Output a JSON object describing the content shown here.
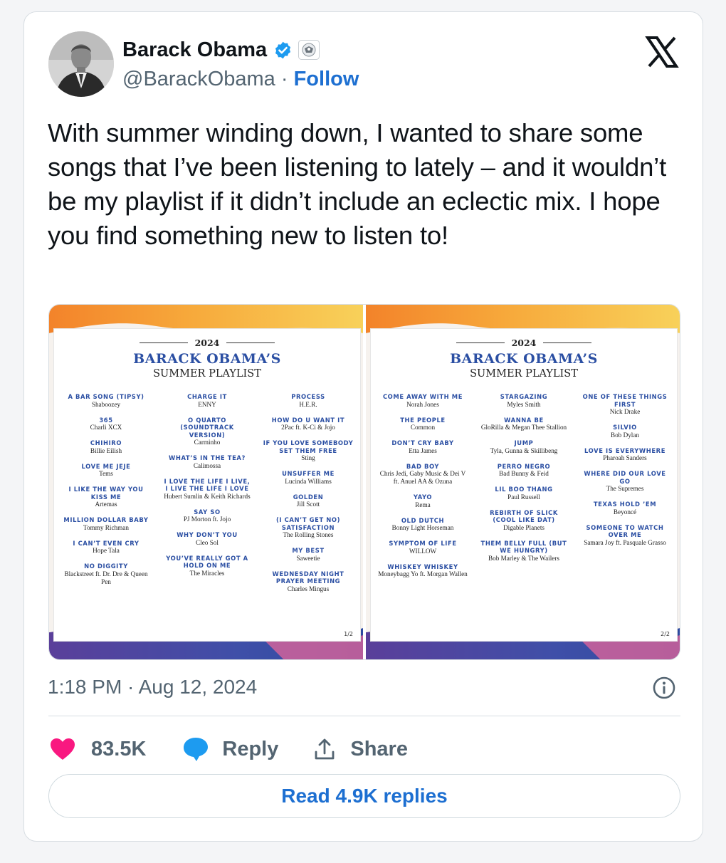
{
  "tweet": {
    "author_name": "Barack Obama",
    "handle": "@BarackObama",
    "separator": "·",
    "follow_label": "Follow",
    "text": "With summer winding down, I wanted to share some songs that I’ve been listening to lately – and it wouldn’t be my playlist if it didn’t include an eclectic mix. I hope you find something new to listen to!",
    "timestamp": "1:18 PM · Aug 12, 2024",
    "like_count": "83.5K",
    "reply_label": "Reply",
    "share_label": "Share",
    "read_replies_label": "Read 4.9K replies"
  },
  "colors": {
    "follow_blue": "#1d6fd1",
    "heart_red": "#f91880",
    "bubble_blue": "#1d9bf0",
    "playlist_blue": "#2b4fa3"
  },
  "icons": [
    "verified-badge-icon",
    "government-seal-icon",
    "x-logo-icon",
    "info-icon",
    "heart-icon",
    "reply-bubble-icon",
    "share-icon"
  ],
  "playlist_images": [
    {
      "year": "2024",
      "title": "BARACK OBAMA’S",
      "subtitle": "SUMMER PLAYLIST",
      "page": "1/2",
      "columns": [
        [
          {
            "title": "A BAR SONG (TIPSY)",
            "artist": "Shaboozey"
          },
          {
            "title": "365",
            "artist": "Charli XCX"
          },
          {
            "title": "CHIHIRO",
            "artist": "Billie Eilish"
          },
          {
            "title": "LOVE ME JEJE",
            "artist": "Tems"
          },
          {
            "title": "I LIKE THE WAY YOU KISS ME",
            "artist": "Artemas"
          },
          {
            "title": "MILLION DOLLAR BABY",
            "artist": "Tommy Richman"
          },
          {
            "title": "I CAN’T EVEN CRY",
            "artist": "Hope Tala"
          },
          {
            "title": "NO DIGGITY",
            "artist": "Blackstreet ft. Dr. Dre & Queen Pen"
          }
        ],
        [
          {
            "title": "CHARGE IT",
            "artist": "ENNY"
          },
          {
            "title": "O QUARTO (SOUNDTRACK VERSION)",
            "artist": "Carminho"
          },
          {
            "title": "WHAT’S IN THE TEA?",
            "artist": "Calimossa"
          },
          {
            "title": "I LOVE THE LIFE I LIVE, I LIVE THE LIFE I LOVE",
            "artist": "Hubert Sumlin & Keith Richards"
          },
          {
            "title": "SAY SO",
            "artist": "PJ Morton ft. Jojo"
          },
          {
            "title": "WHY DON’T YOU",
            "artist": "Cleo Sol"
          },
          {
            "title": "YOU’VE REALLY GOT A HOLD ON ME",
            "artist": "The Miracles"
          }
        ],
        [
          {
            "title": "PROCESS",
            "artist": "H.E.R."
          },
          {
            "title": "HOW DO U WANT IT",
            "artist": "2Pac ft. K-Ci & Jojo"
          },
          {
            "title": "IF YOU LOVE SOMEBODY SET THEM FREE",
            "artist": "Sting"
          },
          {
            "title": "UNSUFFER ME",
            "artist": "Lucinda Williams"
          },
          {
            "title": "GOLDEN",
            "artist": "Jill Scott"
          },
          {
            "title": "(I CAN’T GET NO) SATISFACTION",
            "artist": "The Rolling Stones"
          },
          {
            "title": "MY BEST",
            "artist": "Saweetie"
          },
          {
            "title": "WEDNESDAY NIGHT PRAYER MEETING",
            "artist": "Charles Mingus"
          }
        ]
      ]
    },
    {
      "year": "2024",
      "title": "BARACK OBAMA’S",
      "subtitle": "SUMMER PLAYLIST",
      "page": "2/2",
      "columns": [
        [
          {
            "title": "COME AWAY WITH ME",
            "artist": "Norah Jones"
          },
          {
            "title": "THE PEOPLE",
            "artist": "Common"
          },
          {
            "title": "DON’T CRY BABY",
            "artist": "Etta James"
          },
          {
            "title": "BAD BOY",
            "artist": "Chris Jedi, Gaby Music & Dei V ft. Anuel AA & Ozuna"
          },
          {
            "title": "YAYO",
            "artist": "Rema"
          },
          {
            "title": "OLD DUTCH",
            "artist": "Bonny Light Horseman"
          },
          {
            "title": "SYMPTOM OF LIFE",
            "artist": "WILLOW"
          },
          {
            "title": "WHISKEY WHISKEY",
            "artist": "Moneybagg Yo ft. Morgan Wallen"
          }
        ],
        [
          {
            "title": "STARGAZING",
            "artist": "Myles Smith"
          },
          {
            "title": "WANNA BE",
            "artist": "GloRilla & Megan Thee Stallion"
          },
          {
            "title": "JUMP",
            "artist": "Tyla, Gunna & Skillibeng"
          },
          {
            "title": "PERRO NEGRO",
            "artist": "Bad Bunny & Feid"
          },
          {
            "title": "LIL BOO THANG",
            "artist": "Paul Russell"
          },
          {
            "title": "REBIRTH OF SLICK (COOL LIKE DAT)",
            "artist": "Digable Planets"
          },
          {
            "title": "THEM BELLY FULL (BUT WE HUNGRY)",
            "artist": "Bob Marley & The Wailers"
          }
        ],
        [
          {
            "title": "ONE OF THESE THINGS FIRST",
            "artist": "Nick Drake"
          },
          {
            "title": "SILVIO",
            "artist": "Bob Dylan"
          },
          {
            "title": "LOVE IS EVERYWHERE",
            "artist": "Pharoah Sanders"
          },
          {
            "title": "WHERE DID OUR LOVE GO",
            "artist": "The Supremes"
          },
          {
            "title": "TEXAS HOLD ’EM",
            "artist": "Beyoncé"
          },
          {
            "title": "SOMEONE TO WATCH OVER ME",
            "artist": "Samara Joy ft. Pasquale Grasso"
          }
        ]
      ]
    }
  ]
}
